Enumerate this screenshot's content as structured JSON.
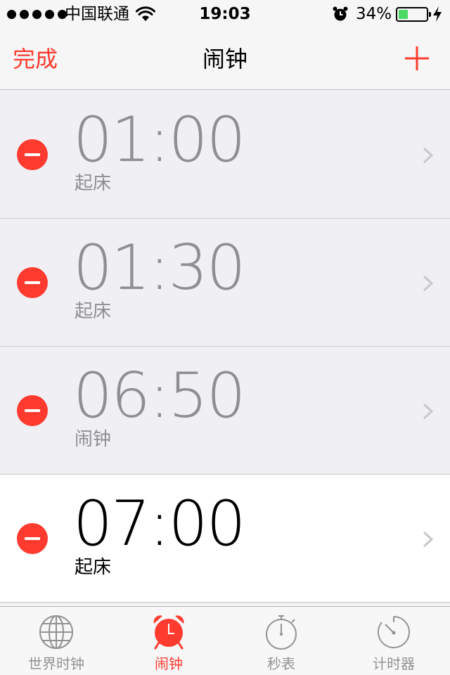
{
  "status_bar": {
    "carrier": "中国联通",
    "time": "19:03",
    "battery_percent": "34%",
    "battery_level": 0.34,
    "icons": [
      "signal-dots",
      "wifi-icon",
      "alarm-clock-icon",
      "battery-icon",
      "charging-bolt-icon"
    ]
  },
  "nav": {
    "done_label": "完成",
    "title": "闹钟",
    "add_icon": "plus-icon"
  },
  "alarms": [
    {
      "time": "01:00",
      "label": "起床",
      "enabled": false
    },
    {
      "time": "01:30",
      "label": "起床",
      "enabled": false
    },
    {
      "time": "06:50",
      "label": "闹钟",
      "enabled": false
    },
    {
      "time": "07:00",
      "label": "起床",
      "enabled": true
    }
  ],
  "tab_bar": {
    "tabs": [
      {
        "label": "世界时钟",
        "icon": "globe-icon",
        "active": false
      },
      {
        "label": "闹钟",
        "icon": "alarm-clock-icon",
        "active": true
      },
      {
        "label": "秒表",
        "icon": "stopwatch-icon",
        "active": false
      },
      {
        "label": "计时器",
        "icon": "timer-icon",
        "active": false
      }
    ]
  },
  "colors": {
    "accent": "#ff3b30",
    "battery_green": "#4cd964",
    "disabled_text": "#8e8e93",
    "inactive_tab": "#929292"
  }
}
